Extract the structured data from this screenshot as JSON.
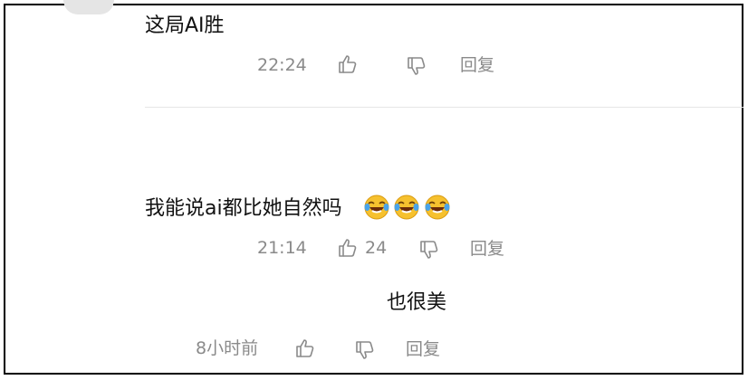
{
  "comments": [
    {
      "text": "这局AI胜",
      "time": "22:24",
      "like_count": "",
      "reply_label": "回复"
    },
    {
      "text": "我能说ai都比她自然吗",
      "emoji": "laugh-cry-emoji",
      "emoji_count": 3,
      "time": "21:14",
      "like_count": "24",
      "reply_label": "回复"
    },
    {
      "text": "也很美",
      "time": "8小时前",
      "like_count": "",
      "reply_label": "回复"
    }
  ],
  "colors": {
    "text": "#111111",
    "meta": "#8a8a8a",
    "frame": "#000000",
    "divider": "#e6e6e6"
  },
  "icons": [
    "thumbs-up-icon",
    "thumbs-down-icon",
    "laugh-cry-emoji"
  ]
}
